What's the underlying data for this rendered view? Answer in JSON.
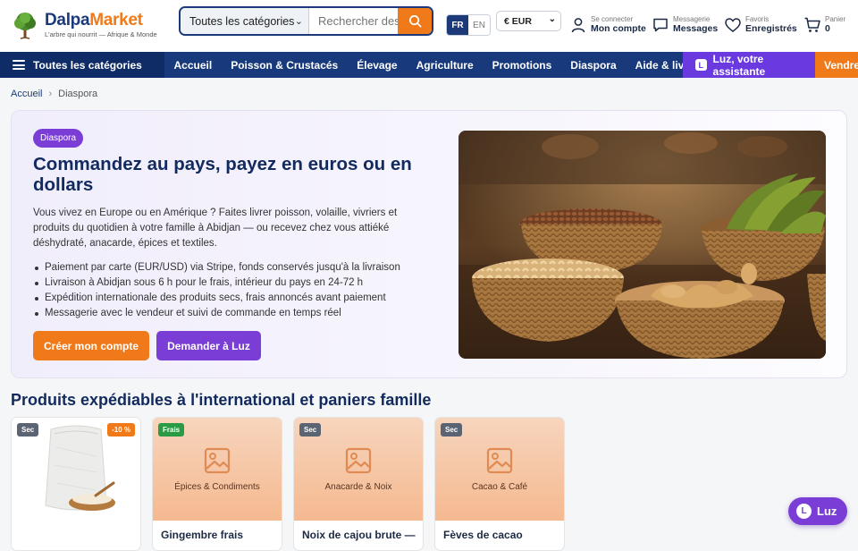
{
  "brand": {
    "name_part1": "Dalpa",
    "name_part2": "Market",
    "tagline": "L'arbre qui nourrit — Afrique & Monde"
  },
  "search": {
    "category": "Toutes les catégories",
    "placeholder": "Rechercher des produits"
  },
  "language": {
    "options": [
      "FR",
      "EN"
    ],
    "selected": "FR"
  },
  "currency": {
    "selected": "€ EUR"
  },
  "header_actions": {
    "account": {
      "small": "Se connecter",
      "big": "Mon compte"
    },
    "messages": {
      "small": "Messagerie",
      "big": "Messages"
    },
    "favorites": {
      "small": "Favoris",
      "big": "Enregistrés"
    },
    "cart": {
      "small": "Panier",
      "big": "0"
    }
  },
  "nav": {
    "all_categories": "Toutes les catégories",
    "items": [
      "Accueil",
      "Poisson & Crustacés",
      "Élevage",
      "Agriculture",
      "Promotions",
      "Diaspora",
      "Aide & livraison"
    ],
    "luz": "Luz, votre assistante",
    "luz_icon": "L",
    "sell": "Vendre"
  },
  "breadcrumb": {
    "home": "Accueil",
    "current": "Diaspora"
  },
  "hero": {
    "badge": "Diaspora",
    "title": "Commandez au pays, payez en euros ou en dollars",
    "description": "Vous vivez en Europe ou en Amérique ? Faites livrer poisson, volaille, vivriers et produits du quotidien à votre famille à Abidjan — ou recevez chez vous attiéké déshydraté, anacarde, épices et textiles.",
    "bullets": [
      "Paiement par carte (EUR/USD) via Stripe, fonds conservés jusqu'à la livraison",
      "Livraison à Abidjan sous 6 h pour le frais, intérieur du pays en 24-72 h",
      "Expédition internationale des produits secs, frais annoncés avant paiement",
      "Messagerie avec le vendeur et suivi de commande en temps réel"
    ],
    "cta_primary": "Créer mon compte",
    "cta_secondary": "Demander à Luz"
  },
  "products": {
    "section_title": "Produits expédiables à l'international et paniers famille",
    "items": [
      {
        "tag": "Sec",
        "discount": "-10 %",
        "category": "",
        "name": ""
      },
      {
        "tag": "Frais",
        "discount": "",
        "category": "Épices & Condiments",
        "name": "Gingembre frais"
      },
      {
        "tag": "Sec",
        "discount": "",
        "category": "Anacarde & Noix",
        "name": "Noix de cajou brute —"
      },
      {
        "tag": "Sec",
        "discount": "",
        "category": "Cacao & Café",
        "name": "Fèves de cacao"
      }
    ]
  },
  "luz_float": {
    "icon": "L",
    "label": "Luz"
  },
  "colors": {
    "navy": "#183a7c",
    "orange": "#f07a1a",
    "purple": "#7a3ed6"
  }
}
